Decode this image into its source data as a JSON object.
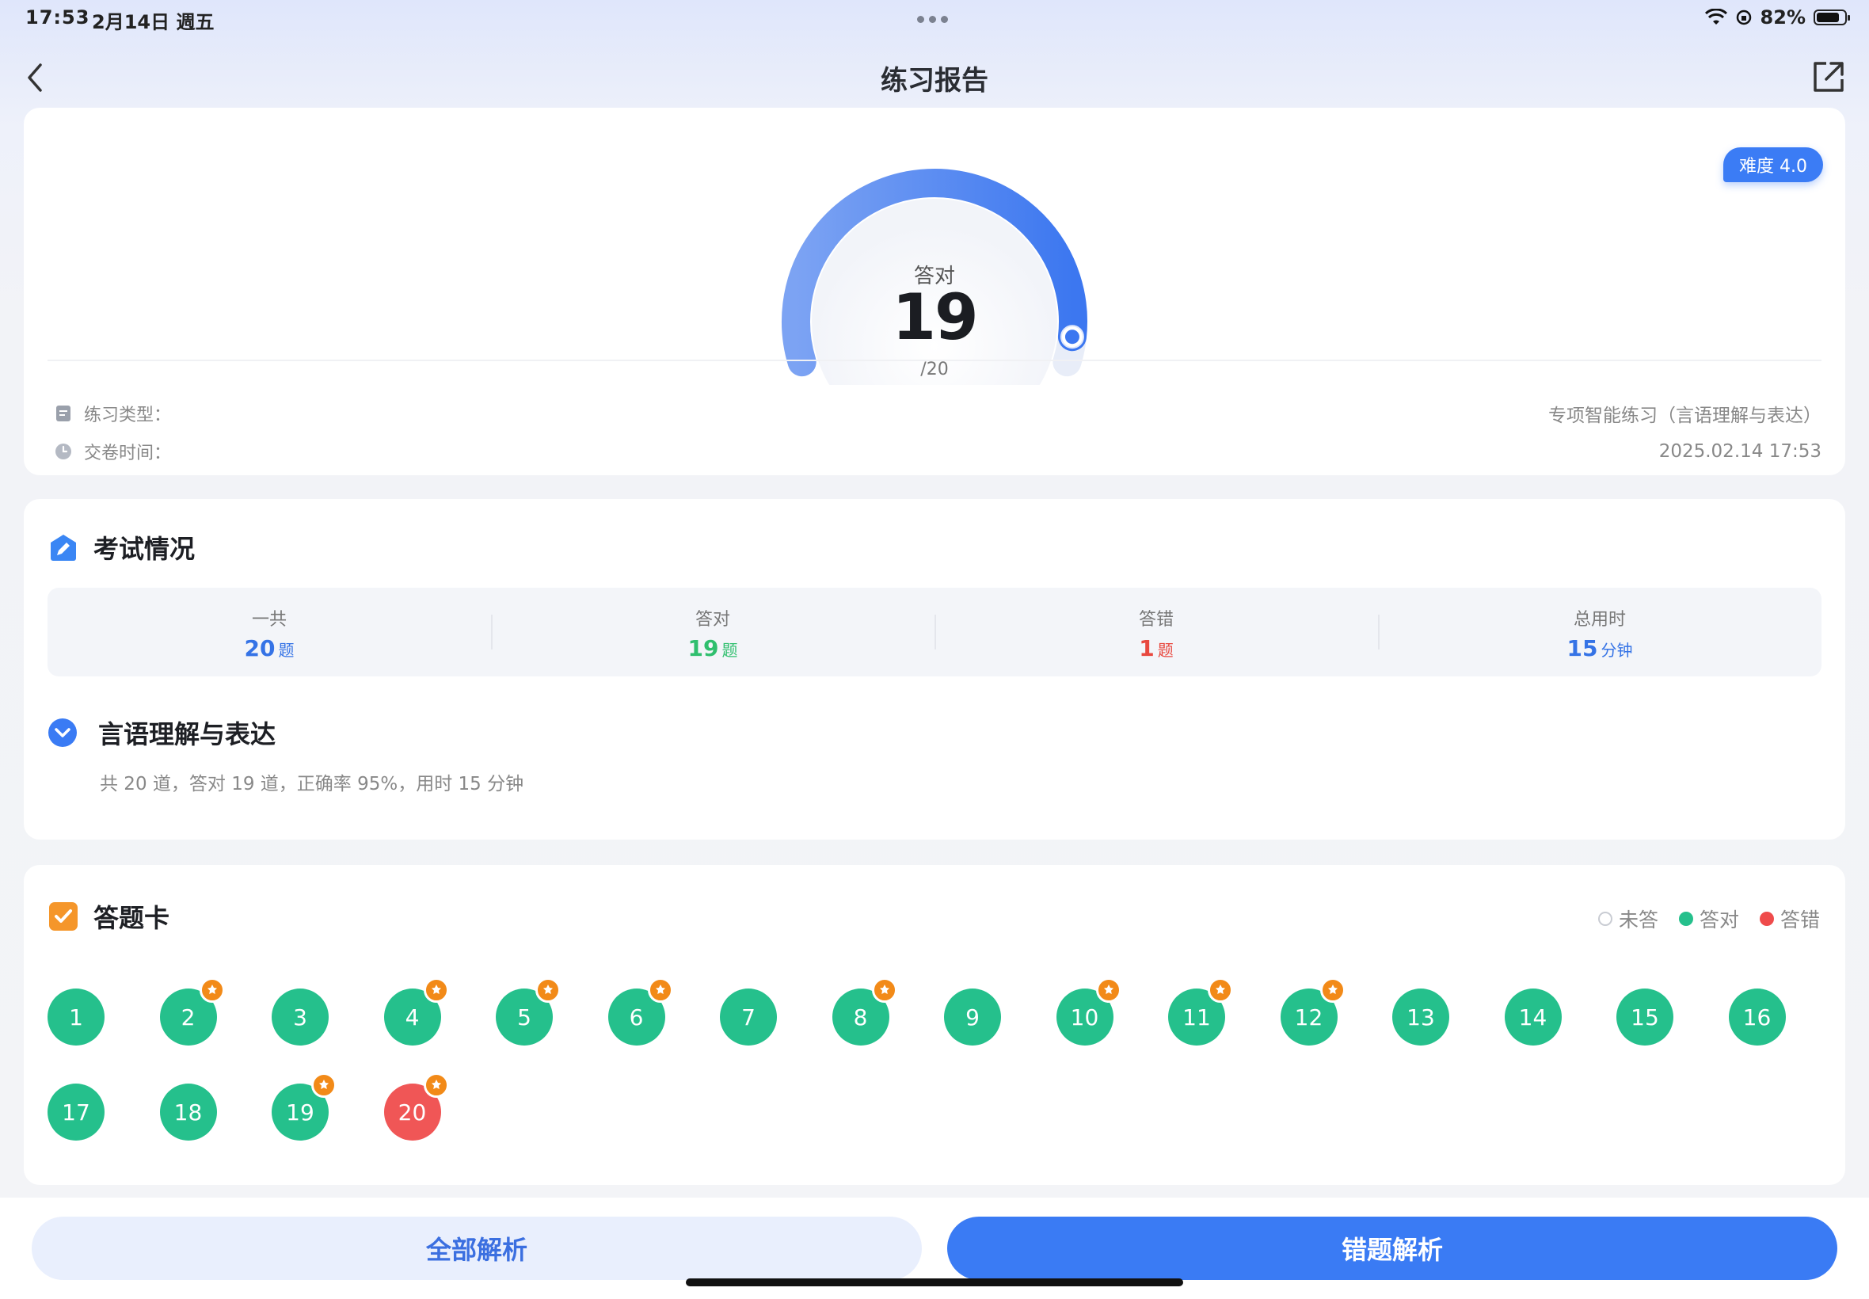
{
  "status_bar": {
    "time": "17:53",
    "date": "2月14日 週五",
    "battery": "82%",
    "battery_level": 0.82
  },
  "nav": {
    "title": "练习报告",
    "back_icon": "chevron-left-icon",
    "share_icon": "share-icon"
  },
  "summary": {
    "difficulty": "难度 4.0",
    "gauge_label": "答对",
    "correct": "19",
    "total": "/20",
    "gauge_fraction": 0.95,
    "type_label": "练习类型：",
    "type_value": "专项智能练习（言语理解与表达）",
    "time_label": "交卷时间：",
    "time_value": "2025.02.14 17:53"
  },
  "exam": {
    "title": "考试情况",
    "stats": [
      {
        "label": "一共",
        "value": "20",
        "unit": "题",
        "color": "#3573e6"
      },
      {
        "label": "答对",
        "value": "19",
        "unit": "题",
        "color": "#2fbf6e"
      },
      {
        "label": "答错",
        "value": "1",
        "unit": "题",
        "color": "#e8483f"
      },
      {
        "label": "总用时",
        "value": "15",
        "unit": "分钟",
        "color": "#3573e6"
      }
    ],
    "section_title": "言语理解与表达",
    "section_desc": "共 20 道，答对 19 道，正确率 95%，用时 15 分钟"
  },
  "answer_card": {
    "title": "答题卡",
    "legend": {
      "unanswered": "未答",
      "correct": "答对",
      "wrong": "答错"
    },
    "colors": {
      "correct": "#25c08c",
      "wrong": "#f05656",
      "pin": "#f28a18"
    },
    "questions": [
      {
        "n": "1",
        "status": "correct",
        "pinned": false
      },
      {
        "n": "2",
        "status": "correct",
        "pinned": true
      },
      {
        "n": "3",
        "status": "correct",
        "pinned": false
      },
      {
        "n": "4",
        "status": "correct",
        "pinned": true
      },
      {
        "n": "5",
        "status": "correct",
        "pinned": true
      },
      {
        "n": "6",
        "status": "correct",
        "pinned": true
      },
      {
        "n": "7",
        "status": "correct",
        "pinned": false
      },
      {
        "n": "8",
        "status": "correct",
        "pinned": true
      },
      {
        "n": "9",
        "status": "correct",
        "pinned": false
      },
      {
        "n": "10",
        "status": "correct",
        "pinned": true
      },
      {
        "n": "11",
        "status": "correct",
        "pinned": true
      },
      {
        "n": "12",
        "status": "correct",
        "pinned": true
      },
      {
        "n": "13",
        "status": "correct",
        "pinned": false
      },
      {
        "n": "14",
        "status": "correct",
        "pinned": false
      },
      {
        "n": "15",
        "status": "correct",
        "pinned": false
      },
      {
        "n": "16",
        "status": "correct",
        "pinned": false
      },
      {
        "n": "17",
        "status": "correct",
        "pinned": false
      },
      {
        "n": "18",
        "status": "correct",
        "pinned": false
      },
      {
        "n": "19",
        "status": "correct",
        "pinned": true
      },
      {
        "n": "20",
        "status": "wrong",
        "pinned": true
      }
    ]
  },
  "bottom": {
    "all_label": "全部解析",
    "wrong_label": "错题解析"
  }
}
